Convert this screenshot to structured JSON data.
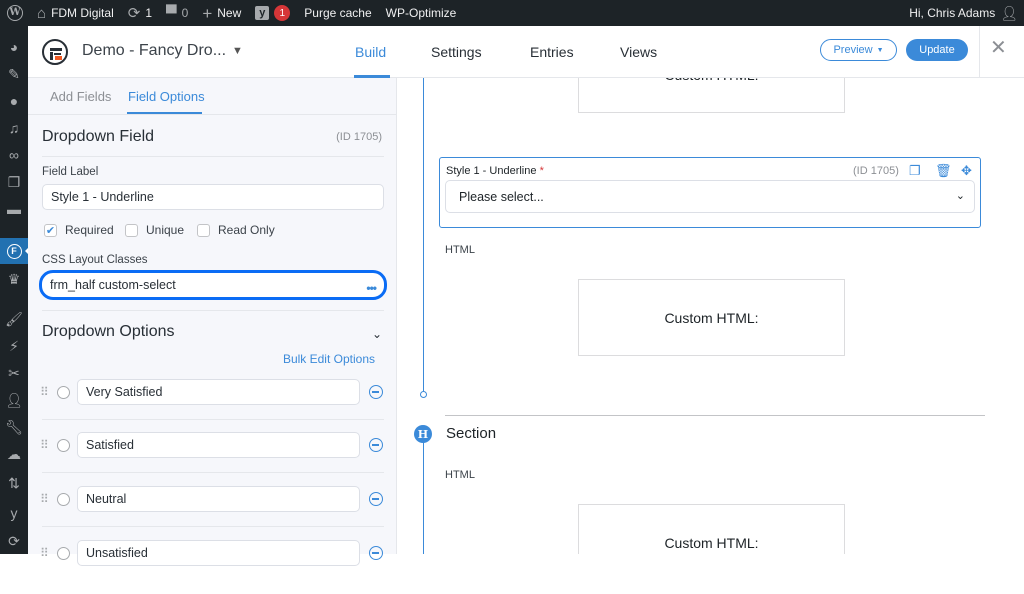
{
  "admin_bar": {
    "wp_logo": "wordpress-icon",
    "site_name": "FDM Digital",
    "updates_count": "1",
    "comments_count": "0",
    "new_label": "New",
    "yoast_badge": "1",
    "purge_cache": "Purge cache",
    "wp_optimize": "WP-Optimize",
    "greeting": "Hi, Chris Adams"
  },
  "side_menu": {
    "items": [
      "dashboard",
      "posts",
      "media",
      "pages",
      "links",
      "pages-copy",
      "comments",
      "formidable",
      "theme",
      "appearance",
      "plugins",
      "snippets",
      "users",
      "tools",
      "feedback",
      "settings",
      "yoast",
      "more"
    ],
    "active": "formidable"
  },
  "header": {
    "form_title": "Demo - Fancy Dro...",
    "tabs": [
      {
        "label": "Build",
        "active": true
      },
      {
        "label": "Settings",
        "active": false
      },
      {
        "label": "Entries",
        "active": false
      },
      {
        "label": "Views",
        "active": false
      }
    ],
    "preview_label": "Preview",
    "update_label": "Update"
  },
  "left_panel": {
    "subtabs": [
      {
        "label": "Add Fields",
        "active": false
      },
      {
        "label": "Field Options",
        "active": true
      }
    ],
    "field_type_title": "Dropdown Field",
    "field_id": "(ID 1705)",
    "field_label_caption": "Field Label",
    "field_label_value": "Style 1 - Underline",
    "checkboxes": [
      {
        "label": "Required",
        "checked": true
      },
      {
        "label": "Unique",
        "checked": false
      },
      {
        "label": "Read Only",
        "checked": false
      }
    ],
    "css_classes_caption": "CSS Layout Classes",
    "css_classes_value": "frm_half custom-select",
    "dropdown_options_title": "Dropdown Options",
    "bulk_edit_label": "Bulk Edit Options",
    "options": [
      "Very Satisfied",
      "Satisfied",
      "Neutral",
      "Unsatisfied"
    ]
  },
  "canvas": {
    "top_html_text": "Custom HTML:",
    "field_card": {
      "label": "Style 1 - Underline",
      "required_mark": "*",
      "id": "(ID 1705)",
      "placeholder": "Please select..."
    },
    "html_label_1": "HTML",
    "html_box_1": "Custom HTML:",
    "section_title": "Section",
    "html_label_2": "HTML",
    "html_box_2": "Custom HTML:"
  },
  "colors": {
    "accent": "#3b8ad9",
    "admin_bar": "#1d2327",
    "focus_ring": "#0a6cf5",
    "badge": "#d63638"
  }
}
